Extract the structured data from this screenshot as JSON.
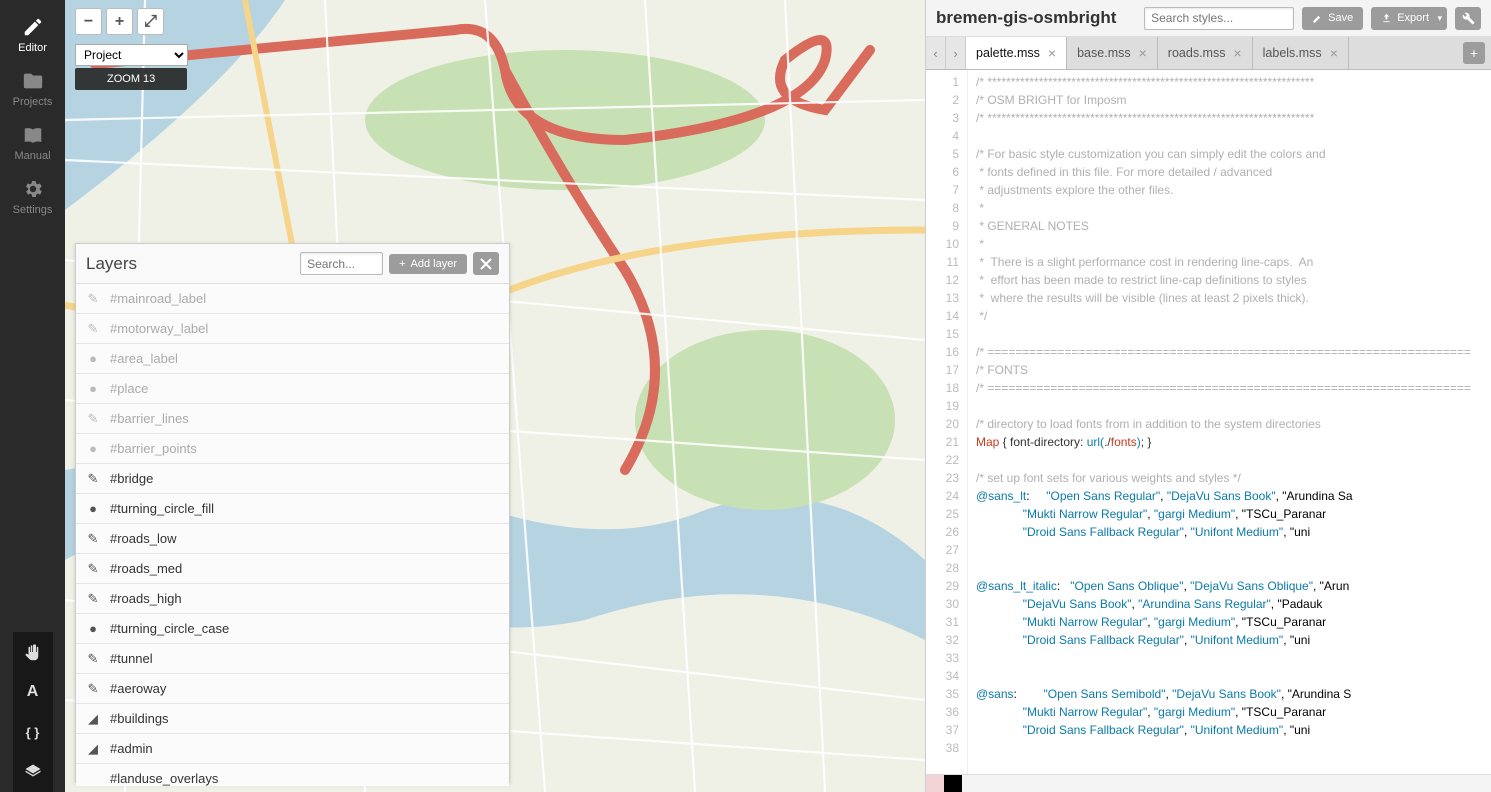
{
  "sidebar": {
    "items": [
      {
        "label": "Editor",
        "icon": "pencil"
      },
      {
        "label": "Projects",
        "icon": "folder"
      },
      {
        "label": "Manual",
        "icon": "book"
      },
      {
        "label": "Settings",
        "icon": "gear"
      }
    ],
    "tools": [
      "hand",
      "font",
      "braces",
      "layers"
    ]
  },
  "map": {
    "zoom_label": "ZOOM 13",
    "project_select": "Project",
    "buttons": {
      "zoom_out": "−",
      "zoom_in": "+",
      "full": "⤢"
    }
  },
  "layersPanel": {
    "title": "Layers",
    "search_placeholder": "Search...",
    "add_label": "Add layer",
    "items": [
      {
        "name": "#mainroad_label",
        "muted": true,
        "icon": "pen"
      },
      {
        "name": "#motorway_label",
        "muted": true,
        "icon": "pen"
      },
      {
        "name": "#area_label",
        "muted": true,
        "icon": "dot"
      },
      {
        "name": "#place",
        "muted": true,
        "icon": "dot"
      },
      {
        "name": "#barrier_lines",
        "muted": true,
        "icon": "pen"
      },
      {
        "name": "#barrier_points",
        "muted": true,
        "icon": "dot"
      },
      {
        "name": "#bridge",
        "muted": false,
        "icon": "pen"
      },
      {
        "name": "#turning_circle_fill",
        "muted": false,
        "icon": "dot"
      },
      {
        "name": "#roads_low",
        "muted": false,
        "icon": "pen"
      },
      {
        "name": "#roads_med",
        "muted": false,
        "icon": "pen"
      },
      {
        "name": "#roads_high",
        "muted": false,
        "icon": "pen"
      },
      {
        "name": "#turning_circle_case",
        "muted": false,
        "icon": "dot"
      },
      {
        "name": "#tunnel",
        "muted": false,
        "icon": "pen"
      },
      {
        "name": "#aeroway",
        "muted": false,
        "icon": "pen"
      },
      {
        "name": "#buildings",
        "muted": false,
        "icon": "poly"
      },
      {
        "name": "#admin",
        "muted": false,
        "icon": "poly"
      },
      {
        "name": "#landuse_overlays",
        "muted": false,
        "icon": ""
      }
    ]
  },
  "project": {
    "name": "bremen-gis-osmbright",
    "search_placeholder": "Search styles...",
    "save_label": "Save",
    "export_label": "Export"
  },
  "tabs": [
    {
      "label": "palette.mss",
      "active": true
    },
    {
      "label": "base.mss",
      "active": false
    },
    {
      "label": "roads.mss",
      "active": false
    },
    {
      "label": "labels.mss",
      "active": false
    }
  ],
  "editor": {
    "lines": [
      {
        "t": "com",
        "s": "/* **********************************************************************"
      },
      {
        "t": "com",
        "s": "/* OSM BRIGHT for Imposm"
      },
      {
        "t": "com",
        "s": "/* **********************************************************************"
      },
      {
        "t": "",
        "s": ""
      },
      {
        "t": "com",
        "s": "/* For basic style customization you can simply edit the colors and"
      },
      {
        "t": "com",
        "s": " * fonts defined in this file. For more detailed / advanced"
      },
      {
        "t": "com",
        "s": " * adjustments explore the other files."
      },
      {
        "t": "com",
        "s": " *"
      },
      {
        "t": "com",
        "s": " * GENERAL NOTES"
      },
      {
        "t": "com",
        "s": " *"
      },
      {
        "t": "com",
        "s": " *  There is a slight performance cost in rendering line-caps.  An"
      },
      {
        "t": "com",
        "s": " *  effort has been made to restrict line-cap definitions to styles"
      },
      {
        "t": "com",
        "s": " *  where the results will be visible (lines at least 2 pixels thick)."
      },
      {
        "t": "com",
        "s": " */"
      },
      {
        "t": "",
        "s": ""
      },
      {
        "t": "com",
        "s": "/* ====================================================================="
      },
      {
        "t": "com",
        "s": "/* FONTS"
      },
      {
        "t": "com",
        "s": "/* ====================================================================="
      },
      {
        "t": "",
        "s": ""
      },
      {
        "t": "com",
        "s": "/* directory to load fonts from in addition to the system directories"
      },
      {
        "t": "map",
        "s": "Map { font-directory: url(./fonts); }"
      },
      {
        "t": "",
        "s": ""
      },
      {
        "t": "com",
        "s": "/* set up font sets for various weights and styles */"
      },
      {
        "t": "var",
        "s": "@sans_lt:     \"Open Sans Regular\", \"DejaVu Sans Book\", \"Arundina Sa"
      },
      {
        "t": "str",
        "s": "              \"Mukti Narrow Regular\", \"gargi Medium\", \"TSCu_Paranar"
      },
      {
        "t": "str",
        "s": "              \"Droid Sans Fallback Regular\", \"Unifont Medium\", \"uni"
      },
      {
        "t": "",
        "s": ""
      },
      {
        "t": "",
        "s": ""
      },
      {
        "t": "var",
        "s": "@sans_lt_italic:   \"Open Sans Oblique\", \"DejaVu Sans Oblique\", \"Arun"
      },
      {
        "t": "str",
        "s": "              \"DejaVu Sans Book\", \"Arundina Sans Regular\", \"Padauk "
      },
      {
        "t": "str",
        "s": "              \"Mukti Narrow Regular\", \"gargi Medium\", \"TSCu_Paranar"
      },
      {
        "t": "str",
        "s": "              \"Droid Sans Fallback Regular\", \"Unifont Medium\", \"uni"
      },
      {
        "t": "",
        "s": ""
      },
      {
        "t": "",
        "s": ""
      },
      {
        "t": "var",
        "s": "@sans:        \"Open Sans Semibold\", \"DejaVu Sans Book\", \"Arundina S"
      },
      {
        "t": "str",
        "s": "              \"Mukti Narrow Regular\", \"gargi Medium\", \"TSCu_Paranar"
      },
      {
        "t": "str",
        "s": "              \"Droid Sans Fallback Regular\", \"Unifont Medium\", \"uni"
      },
      {
        "t": "",
        "s": ""
      }
    ]
  }
}
